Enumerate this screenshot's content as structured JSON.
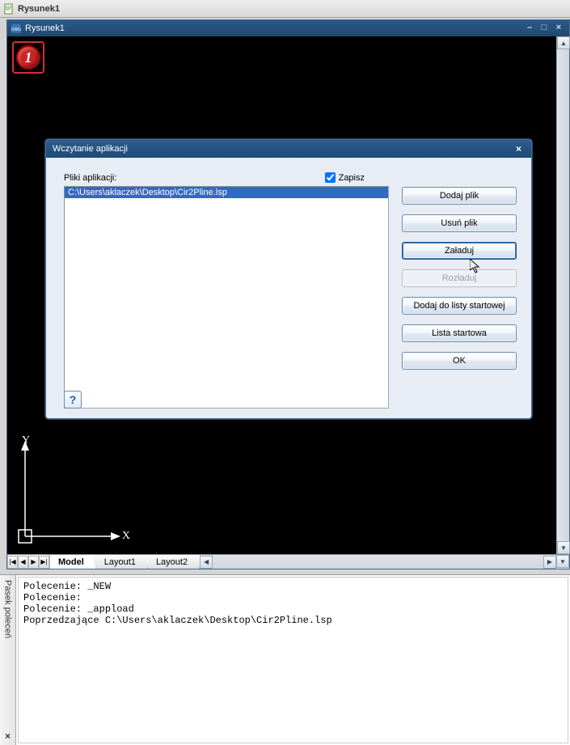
{
  "outer": {
    "title": "Rysunek1"
  },
  "docwin": {
    "title": "Rysunek1"
  },
  "viewport": {
    "badge_number": "1",
    "axis_y": "Y",
    "axis_x": "X"
  },
  "tabbar": {
    "nav": [
      "|◀",
      "◀",
      "▶",
      "▶|"
    ],
    "tabs": [
      {
        "label": "Model",
        "active": true
      },
      {
        "label": "Layout1",
        "active": false
      },
      {
        "label": "Layout2",
        "active": false
      }
    ]
  },
  "dialog": {
    "title": "Wczytanie aplikacji",
    "files_label": "Pliki aplikacji:",
    "save_checkbox": {
      "label": "Zapisz",
      "checked": true
    },
    "files": [
      {
        "path": "C:\\Users\\aklaczek\\Desktop\\Cir2Pline.lsp",
        "selected": true
      }
    ],
    "buttons": {
      "add": "Dodaj plik",
      "remove": "Usuń plik",
      "load": "Załaduj",
      "unload": "Rozładuj",
      "add_start": "Dodaj do listy startowej",
      "start_list": "Lista startowa",
      "ok": "OK"
    },
    "help": "?"
  },
  "cmdpanel": {
    "tab_label": "Pasek poleceń",
    "lines": [
      "Polecenie: _NEW",
      "Polecenie:",
      "Polecenie: _appload",
      "Poprzedzające C:\\Users\\aklaczek\\Desktop\\Cir2Pline.lsp"
    ],
    "close": "×"
  }
}
